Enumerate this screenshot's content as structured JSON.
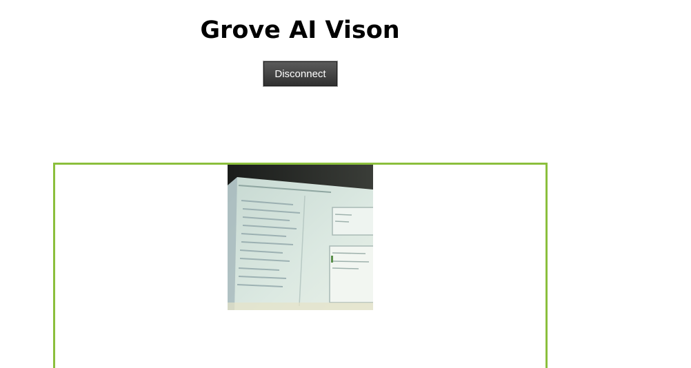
{
  "header": {
    "title": "Grove AI Vison"
  },
  "controls": {
    "disconnect_label": "Disconnect"
  },
  "colors": {
    "frame_border": "#8bbf3c",
    "button_background": "#3f3f3f",
    "button_text": "#ffffff",
    "title_text": "#000000"
  },
  "camera": {
    "content": "live camera feed image"
  }
}
